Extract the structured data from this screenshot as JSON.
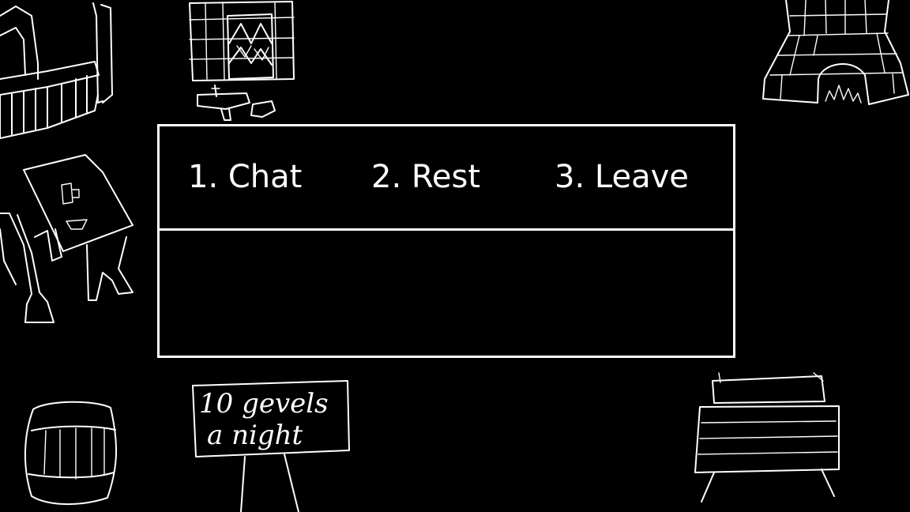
{
  "menu": {
    "options": [
      {
        "key": "1",
        "label": "1. Chat"
      },
      {
        "key": "2",
        "label": "2. Rest"
      },
      {
        "key": "3",
        "label": "3. Leave"
      }
    ]
  },
  "message": {
    "text": ""
  },
  "scenery": {
    "sign_line_1": "10 gevels",
    "sign_line_2": "a night"
  },
  "colors": {
    "background": "#000000",
    "line": "#ffffff"
  }
}
